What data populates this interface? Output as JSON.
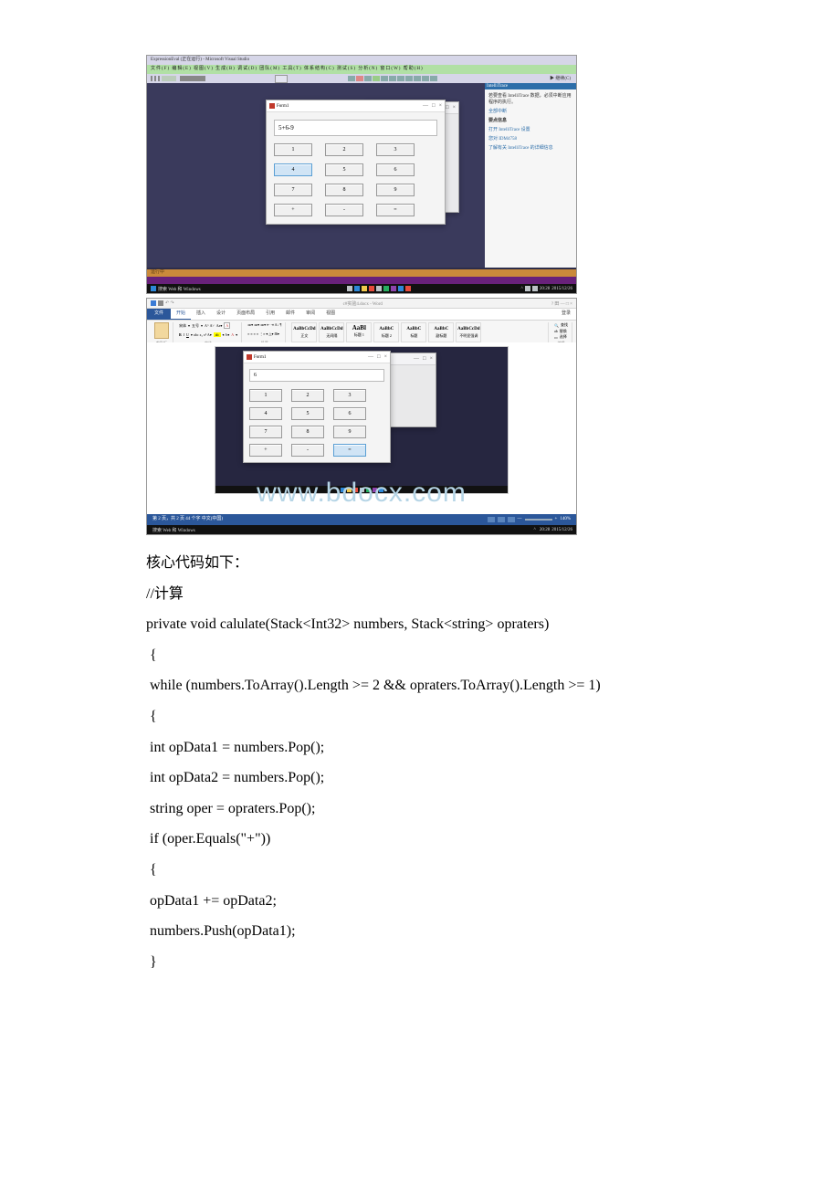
{
  "vs": {
    "title": "ExpressionEval (正在运行) - Microsoft Visual Studio",
    "menu": "文件(F)  编辑(E)  视图(V)  生成(B)  调试(D)  团队(M)  工具(T)  体系结构(C)  测试(S)  分析(N)  窗口(W)  帮助(H)",
    "toolbar_right": "▶ 继续(C)",
    "rightpanel": {
      "header": "IntelliTrace",
      "msg": "若要查看 IntelliTrace 数据，必须中断应用程序的执行。",
      "link1": "全部中断",
      "bold": "要点信息",
      "link2": "打开 IntelliTrace 设置",
      "link3": "您对 IDM4758",
      "link4": "了解有关 IntelliTrace 的详细信息"
    },
    "statusbar": "运行中",
    "taskbar_search": "搜索 Web 和 Windows",
    "taskbar_time": "20:28",
    "taskbar_date": "2015/12/26"
  },
  "calc1": {
    "title": "Form1",
    "display": "5+6-9",
    "buttons": [
      "1",
      "2",
      "3",
      "4",
      "5",
      "6",
      "7",
      "8",
      "9",
      "+",
      "-",
      "="
    ],
    "highlight_index": 3
  },
  "word": {
    "qat_center": "c#实验4.docx - Word",
    "qat_right_icons": "? 田 — □ ×",
    "file_tab": "文件",
    "tabs": [
      "开始",
      "插入",
      "设计",
      "页面布局",
      "引用",
      "邮件",
      "审阅",
      "视图"
    ],
    "login": "登录",
    "paste_label": "粘贴",
    "clipboard_group": "剪贴板",
    "font_label": "宋体",
    "font_size": "五号",
    "font_group": "字体",
    "para_group": "段落",
    "styles": [
      {
        "name": "AaBbCcDd",
        "label": "正文"
      },
      {
        "name": "AaBbCcDd",
        "label": "无间隔"
      },
      {
        "name": "AaBl",
        "label": "标题 1"
      },
      {
        "name": "AaBbC",
        "label": "标题 2"
      },
      {
        "name": "AaBbC",
        "label": "标题"
      },
      {
        "name": "AaBbC",
        "label": "副标题"
      },
      {
        "name": "AaBbCcDd",
        "label": "不明显强调"
      }
    ],
    "style_group": "样式",
    "edit_group_items": [
      "查找",
      "替换",
      "选择"
    ],
    "edit_group": "编辑",
    "status_left": "第 2 页，共 2 页   44 个字   中文(中国)",
    "status_zoom": "140%",
    "taskbar_search": "搜索 Web 和 Windows",
    "taskbar_time": "20:28",
    "taskbar_date": "2015/12/26",
    "watermark": "www.bdocx.com"
  },
  "calc2": {
    "title": "Form1",
    "display": "6",
    "buttons": [
      "1",
      "2",
      "3",
      "4",
      "5",
      "6",
      "7",
      "8",
      "9",
      "+",
      "-",
      "="
    ],
    "highlight_index": 11
  },
  "text": {
    "line0": "核心代码如下：",
    "line1": "//计算",
    "line2": "private void calulate(Stack<Int32> numbers, Stack<string> opraters)",
    "line3": " {",
    "line4": " while (numbers.ToArray().Length >= 2 && opraters.ToArray().Length >= 1)",
    "line5": " {",
    "line6": " int opData1 = numbers.Pop();",
    "line7": " int opData2 = numbers.Pop();",
    "line8": " string oper = opraters.Pop();",
    "line9": " if (oper.Equals(\"+\"))",
    "line10": " {",
    "line11": " opData1 += opData2;",
    "line12": " numbers.Push(opData1);",
    "line13": " }"
  }
}
